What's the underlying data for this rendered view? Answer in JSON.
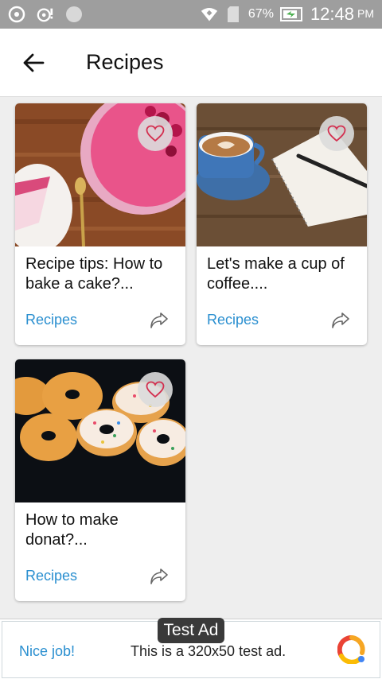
{
  "status_bar": {
    "battery": "67%",
    "time": "12:48",
    "ampm": "PM",
    "icons": [
      "app-icon",
      "notification-icon",
      "circle-icon",
      "wifi-icon",
      "sim-icon",
      "battery-charging-icon"
    ]
  },
  "app_bar": {
    "back_icon": "arrow-left-icon",
    "title": "Recipes"
  },
  "cards": [
    {
      "title": "Recipe tips: How to bake a cake?...",
      "category": "Recipes",
      "image": "cake-photo",
      "fav_icon": "heart-icon",
      "share_icon": "share-icon"
    },
    {
      "title": "Let's make a cup of coffee....",
      "category": "Recipes",
      "image": "coffee-photo",
      "fav_icon": "heart-icon",
      "share_icon": "share-icon"
    },
    {
      "title": "How to make donat?...",
      "category": "Recipes",
      "image": "donuts-photo",
      "fav_icon": "heart-icon",
      "share_icon": "share-icon"
    }
  ],
  "ad": {
    "label": "Test Ad",
    "nice": "Nice job!",
    "text": "This is a 320x50 test ad.",
    "logo_icon": "ad-logo-icon"
  },
  "colors": {
    "accent": "#2a8fd0",
    "status_bar": "#9e9e9e",
    "heart": "#d32f4f"
  }
}
